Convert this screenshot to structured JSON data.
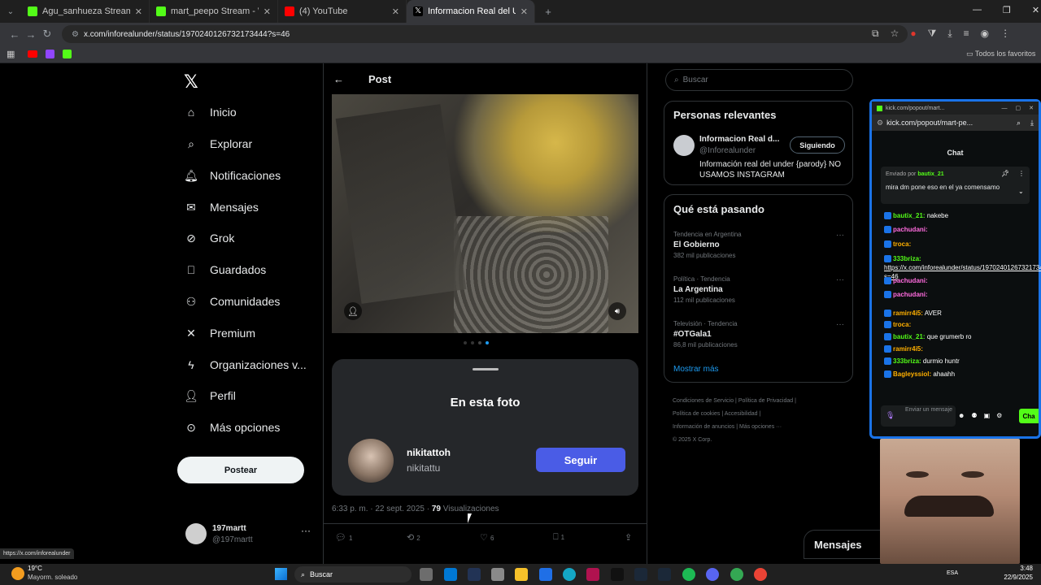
{
  "browser": {
    "tabs": [
      {
        "title": "Agu_sanhueza Stream - Watch",
        "favicon_color": "#53fc18"
      },
      {
        "title": "mart_peepo Stream - Watch Li",
        "favicon_color": "#53fc18"
      },
      {
        "title": "(4) YouTube",
        "favicon_color": "#ff0000"
      },
      {
        "title": "Informacion Real del Under en",
        "favicon_color": "#ffffff",
        "active": true
      }
    ],
    "url": "x.com/inforealunder/status/1970240126732173444?s=46",
    "bookmarks_label": "Todos los favoritos",
    "status_url": "https://x.com/inforealunder"
  },
  "nav": {
    "items": [
      {
        "label": "Inicio",
        "icon": "home-icon"
      },
      {
        "label": "Explorar",
        "icon": "search-icon"
      },
      {
        "label": "Notificaciones",
        "icon": "bell-icon"
      },
      {
        "label": "Mensajes",
        "icon": "mail-icon"
      },
      {
        "label": "Grok",
        "icon": "grok-icon"
      },
      {
        "label": "Guardados",
        "icon": "bookmark-icon"
      },
      {
        "label": "Comunidades",
        "icon": "people-icon"
      },
      {
        "label": "Premium",
        "icon": "x-icon"
      },
      {
        "label": "Organizaciones v...",
        "icon": "bolt-icon"
      },
      {
        "label": "Perfil",
        "icon": "person-icon"
      },
      {
        "label": "Más opciones",
        "icon": "more-circle-icon"
      }
    ],
    "post_button": "Postear",
    "account": {
      "name": "197martt",
      "handle": "@197martt"
    }
  },
  "post": {
    "header": "Post",
    "sheet_title": "En esta foto",
    "tagged_user": {
      "name": "nikitattoh",
      "handle": "nikitattu"
    },
    "follow_button": "Seguir",
    "timestamp": "6:33 p. m. · 22 sept. 2025 ·",
    "views_count": "79",
    "views_label": "Visualizaciones",
    "actions": {
      "replies": "1",
      "reposts": "2",
      "likes": "6",
      "bookmarks": "1"
    }
  },
  "sidebar": {
    "search_placeholder": "Buscar",
    "relevant_title": "Personas relevantes",
    "relevant_person": {
      "name": "Informacion Real d...",
      "handle": "@Inforealunder",
      "bio": "Información real del under {parody} NO USAMOS INSTAGRAM",
      "button": "Siguiendo"
    },
    "whats_happening_title": "Qué está pasando",
    "trends": [
      {
        "category": "Tendencia en Argentina",
        "name": "El Gobierno",
        "count": "382 mil publicaciones"
      },
      {
        "category": "Política · Tendencia",
        "name": "La Argentina",
        "count": "112 mil publicaciones"
      },
      {
        "category": "Televisión · Tendencia",
        "name": "#OTGala1",
        "count": "86,8 mil publicaciones"
      }
    ],
    "show_more": "Mostrar más",
    "footer_links": [
      "Condiciones de Servicio",
      "Política de Privacidad",
      "Política de cookies",
      "Accesibilidad",
      "Información de anuncios",
      "Más opciones ···"
    ],
    "copyright": "© 2025 X Corp."
  },
  "messages_drawer": "Mensajes",
  "kick": {
    "window_title": "kick.com/popout/mart...",
    "url": "kick.com/popout/mart-pe...",
    "chat_title": "Chat",
    "pinned_by_label": "Enviado por",
    "pinned_by_user": "bautix_21",
    "pinned_message": "mira dm pone eso en el ya comensamo",
    "messages": [
      {
        "user": "bautix_21:",
        "text": "nakebe",
        "color": "#53fc18"
      },
      {
        "user": "pachudani:",
        "text": "",
        "color": "#ff6bde"
      },
      {
        "user": "troca:",
        "text": "",
        "color": "#ffb000"
      },
      {
        "user": "333briza:",
        "text": "https://x.com/inforealunder/status/1970240126732173444?s=46",
        "color": "#53fc18"
      },
      {
        "user": "pachudani:",
        "text": "",
        "color": "#ff6bde"
      },
      {
        "user": "pachudani:",
        "text": "",
        "color": "#ff6bde"
      },
      {
        "user": "ramirr4i5:",
        "text": "AVER",
        "color": "#ffb000"
      },
      {
        "user": "troca:",
        "text": "",
        "color": "#ffb000"
      },
      {
        "user": "bautix_21:",
        "text": "que grumerb ro",
        "color": "#53fc18"
      },
      {
        "user": "ramirr4i5:",
        "text": "",
        "color": "#ffb000"
      },
      {
        "user": "333briza:",
        "text": "durmio huntr",
        "color": "#53fc18"
      },
      {
        "user": "Bagleyssiol:",
        "text": "ahaahh",
        "color": "#ffb000"
      }
    ],
    "input_placeholder": "Enviar un mensaje",
    "chat_button": "Cha"
  },
  "taskbar": {
    "weather_temp": "19°C",
    "weather_desc": "Mayorm. soleado",
    "search_label": "Buscar",
    "time": "3:48",
    "date": "22/9/2025",
    "lang": "ESA"
  }
}
